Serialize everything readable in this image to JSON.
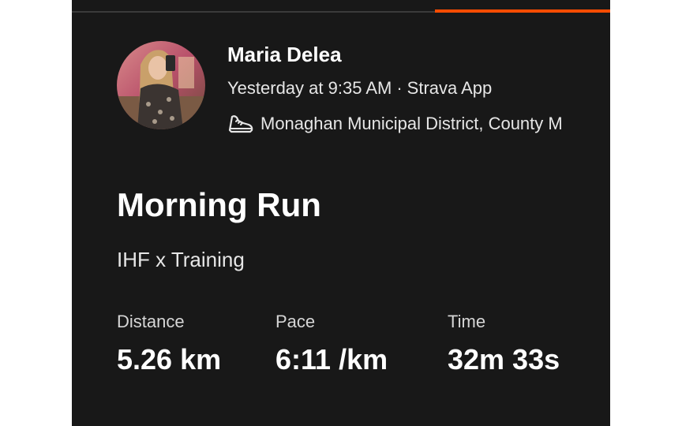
{
  "activity": {
    "athlete_name": "Maria Delea",
    "timestamp": "Yesterday at 9:35 AM",
    "separator": "·",
    "source": "Strava App",
    "location": "Monaghan Municipal District, County M",
    "activity_icon": "running-shoe-icon",
    "title": "Morning Run",
    "description": "IHF x Training",
    "stats": {
      "distance": {
        "label": "Distance",
        "value": "5.26 km"
      },
      "pace": {
        "label": "Pace",
        "value": "6:11 /km"
      },
      "time": {
        "label": "Time",
        "value": "32m 33s"
      }
    }
  },
  "colors": {
    "background": "#181818",
    "accent": "#fc4c02",
    "text_primary": "#ffffff",
    "text_secondary": "#e6e6e6"
  }
}
